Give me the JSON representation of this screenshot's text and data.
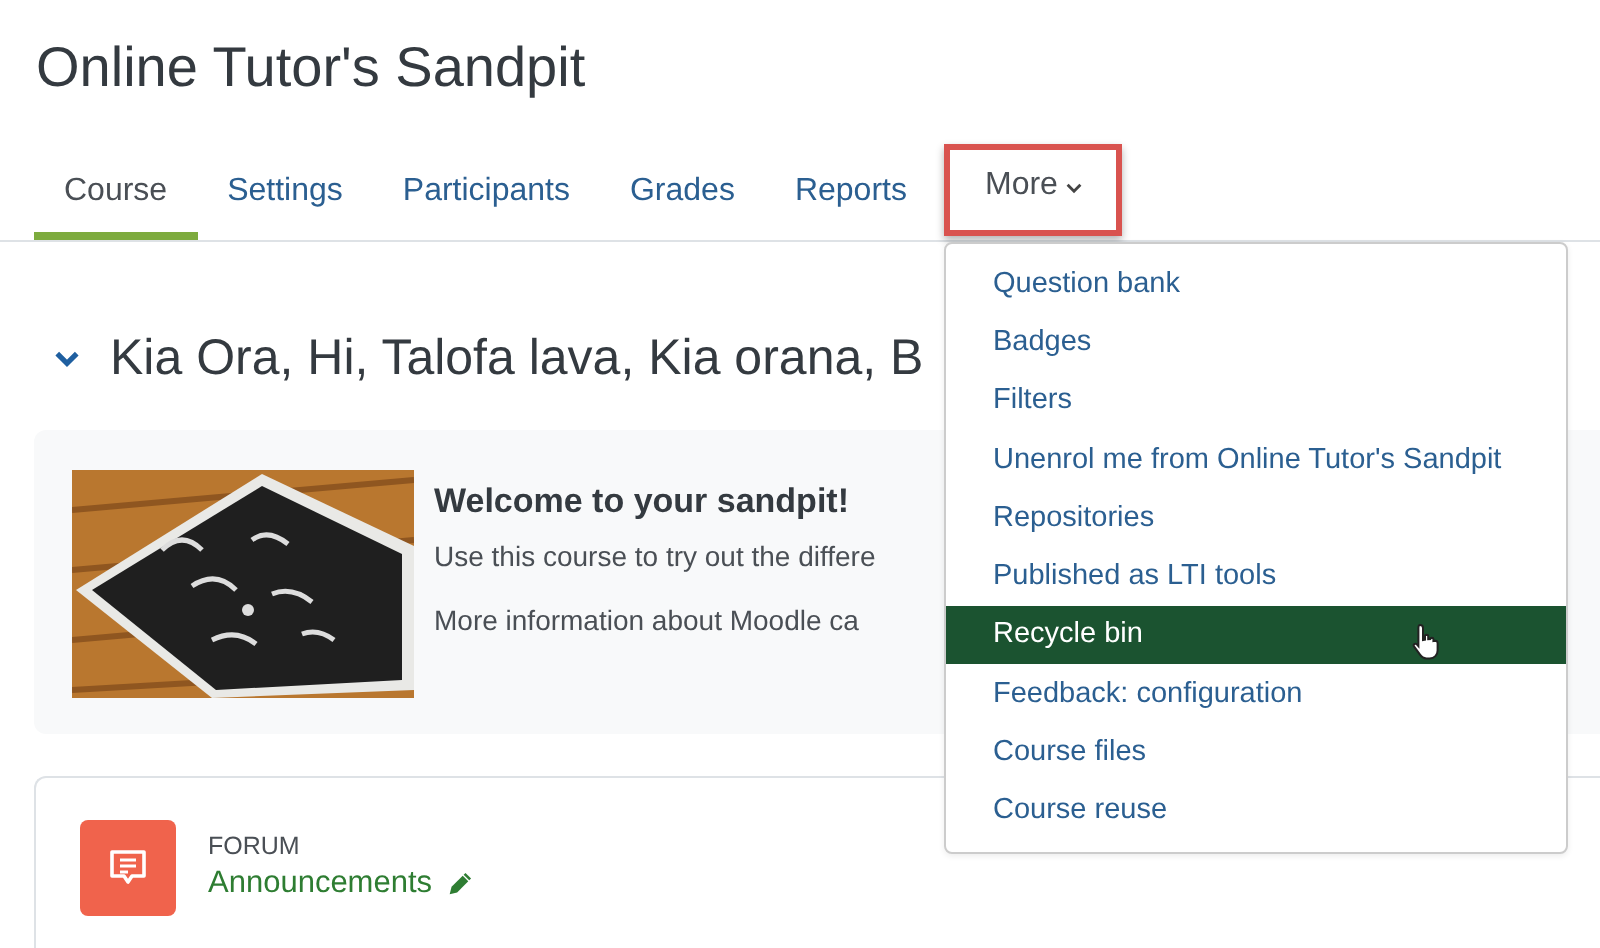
{
  "page_title": "Online Tutor's Sandpit",
  "tabs": [
    {
      "label": "Course",
      "selected": true,
      "highlighted": false,
      "dropdown": false
    },
    {
      "label": "Settings",
      "selected": false,
      "highlighted": false,
      "dropdown": false
    },
    {
      "label": "Participants",
      "selected": false,
      "highlighted": false,
      "dropdown": false
    },
    {
      "label": "Grades",
      "selected": false,
      "highlighted": false,
      "dropdown": false
    },
    {
      "label": "Reports",
      "selected": false,
      "highlighted": false,
      "dropdown": false
    },
    {
      "label": "More",
      "selected": false,
      "highlighted": true,
      "dropdown": true
    }
  ],
  "more_menu": {
    "items": [
      {
        "label": "Question bank",
        "selected": false
      },
      {
        "label": "Badges",
        "selected": false
      },
      {
        "label": "Filters",
        "selected": false
      },
      {
        "label": "Unenrol me from Online Tutor's Sandpit",
        "selected": false
      },
      {
        "label": "Repositories",
        "selected": false
      },
      {
        "label": "Published as LTI tools",
        "selected": false
      },
      {
        "label": "Recycle bin",
        "selected": true
      },
      {
        "label": "Feedback: configuration",
        "selected": false
      },
      {
        "label": "Course files",
        "selected": false
      },
      {
        "label": "Course reuse",
        "selected": false
      }
    ]
  },
  "section": {
    "title": "Kia Ora, Hi, Talofa lava, Kia orana, B",
    "expanded": true
  },
  "welcome": {
    "heading": "Welcome to your sandpit!",
    "lines": [
      "Use this course to try out the differe",
      "More information about Moodle ca"
    ]
  },
  "activity": {
    "type": "FORUM",
    "name": "Announcements"
  }
}
